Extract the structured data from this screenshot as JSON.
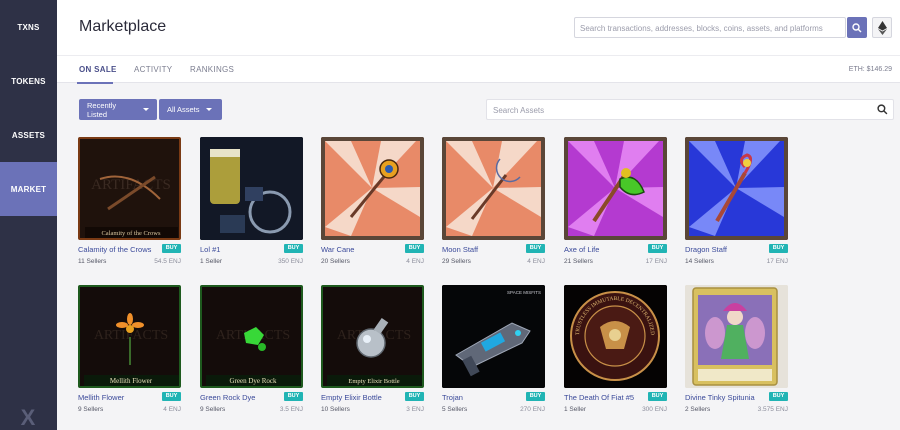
{
  "sidebar": {
    "items": [
      {
        "label": "TXNS"
      },
      {
        "label": "TOKENS"
      },
      {
        "label": "ASSETS"
      },
      {
        "label": "MARKET"
      }
    ],
    "active": "MARKET",
    "logo_glyph": "X"
  },
  "header": {
    "title": "Marketplace",
    "search_placeholder": "Search transactions, addresses, blocks, coins, assets, and platforms"
  },
  "tabs": [
    {
      "label": "ON SALE"
    },
    {
      "label": "ACTIVITY"
    },
    {
      "label": "RANKINGS"
    }
  ],
  "eth_price": "ETH: $146.29",
  "filters": {
    "sort_label": "Recently Listed",
    "category_label": "All Assets",
    "search_placeholder": "Search Assets"
  },
  "buy_label": "BUY",
  "items": [
    {
      "name": "Calamity of the Crows",
      "sellers": "11 Sellers",
      "price": "54.5 ENJ",
      "art": "Calamity of the Crows",
      "icon": "crossbow-icon"
    },
    {
      "name": "Lol #1",
      "sellers": "1 Seller",
      "price": "350 ENJ",
      "art": "",
      "icon": "beer-glass-icon"
    },
    {
      "name": "War Cane",
      "sellers": "20 Sellers",
      "price": "4 ENJ",
      "art": "",
      "icon": "war-cane-icon"
    },
    {
      "name": "Moon Staff",
      "sellers": "29 Sellers",
      "price": "4 ENJ",
      "art": "",
      "icon": "moon-staff-icon"
    },
    {
      "name": "Axe of Life",
      "sellers": "21 Sellers",
      "price": "17 ENJ",
      "art": "",
      "icon": "axe-icon"
    },
    {
      "name": "Dragon Staff",
      "sellers": "14 Sellers",
      "price": "17 ENJ",
      "art": "",
      "icon": "dragon-staff-icon"
    },
    {
      "name": "Mellith Flower",
      "sellers": "9 Sellers",
      "price": "4 ENJ",
      "art": "Mellith Flower",
      "icon": "flower-icon"
    },
    {
      "name": "Green Rock Dye",
      "sellers": "9 Sellers",
      "price": "3.5 ENJ",
      "art": "Green Dye Rock",
      "icon": "rock-dye-icon"
    },
    {
      "name": "Empty Elixir Bottle",
      "sellers": "10 Sellers",
      "price": "3 ENJ",
      "art": "Empty Elixir Bottle",
      "icon": "bottle-icon"
    },
    {
      "name": "Trojan",
      "sellers": "5 Sellers",
      "price": "270 ENJ",
      "art": "SPACE MISFITS",
      "icon": "space-gun-icon"
    },
    {
      "name": "The Death Of Fiat #5",
      "sellers": "1 Seller",
      "price": "300 ENJ",
      "art": "TRUSTLESS IMMUTABLE DECENTRALIZED",
      "icon": "seal-icon"
    },
    {
      "name": "Divine Tinky Spitunia",
      "sellers": "2 Sellers",
      "price": "3.575 ENJ",
      "art": "",
      "icon": "fairy-card-icon"
    }
  ],
  "colors": {
    "sidebar": "#2e3146",
    "accent": "#6b72b8",
    "buy": "#21b4b4",
    "link": "#3b4a9a"
  }
}
